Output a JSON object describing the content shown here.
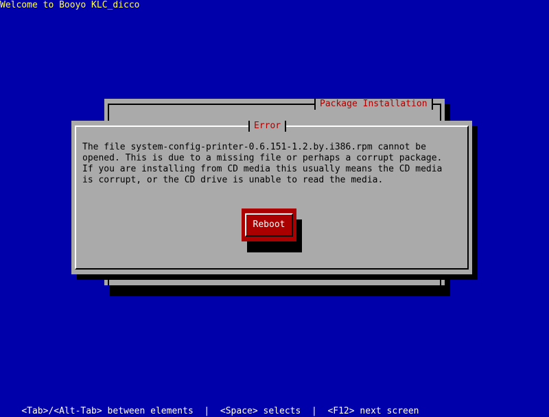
{
  "header": {
    "welcome_text": "Welcome to Booyo KLC_dicco"
  },
  "background_window": {
    "title": "Package Installation"
  },
  "error_dialog": {
    "title": "Error",
    "message": "The file system-config-printer-0.6.151-1.2.by.i386.rpm cannot be\nopened. This is due to a missing file or perhaps a corrupt package.\nIf you are installing from CD media this usually means the CD media\nis corrupt, or the CD drive is unable to read the media.",
    "button_label": "Reboot"
  },
  "statusbar": {
    "tab_hint": "<Tab>/<Alt-Tab> between elements",
    "separator": "|",
    "space_hint": "<Space> selects",
    "f12_hint": "<F12> next screen"
  },
  "colors": {
    "screen_background": "#0000aa",
    "window_background": "#aaaaaa",
    "title_text": "#aa0000",
    "button_background": "#aa0000",
    "button_text": "#ffffff",
    "welcome_text": "#ffff55",
    "statusbar_text": "#ffffff"
  }
}
